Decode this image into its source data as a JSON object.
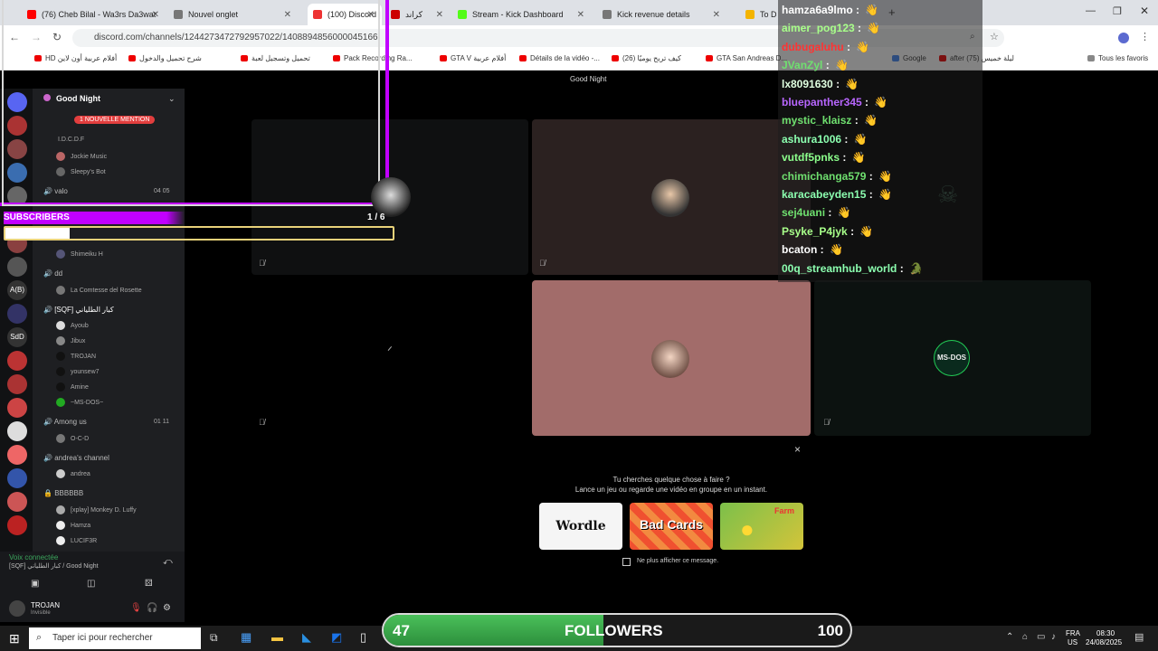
{
  "browser": {
    "tabs": [
      {
        "label": "(76) Cheb Bilal - Wa3rs Da3wat",
        "fav": "#ff0000"
      },
      {
        "label": "Nouvel onglet",
        "fav": "#777777"
      },
      {
        "label": "(100) Discord |",
        "fav": "#e33"
      },
      {
        "label": "كراند",
        "fav": "#c00"
      },
      {
        "label": "Stream - Kick Dashboard",
        "fav": "#53fc18"
      },
      {
        "label": "Kick revenue details",
        "fav": "#777777"
      },
      {
        "label": "To De",
        "fav": "#f4b400"
      }
    ],
    "new_tab": "+",
    "url": "discord.com/channels/1244273472792957022/1408894856000045166",
    "bookmarks": [
      "HD أفلام عربية أون لاين",
      "شرح تحميل والدخول",
      "تحميل وتسجيل لعبة",
      "Pack Recording Ra...",
      "GTA V أفلام عربية",
      "Détails de la vidéo -...",
      "كيف تربح يوميًا (26)",
      "GTA San Andreas D...",
      "Google",
      "after ليلة خميس (75)",
      "Tous les favoris"
    ],
    "window_title": "Good Night"
  },
  "discord": {
    "server_name": "Good Night",
    "new_mention_badge": "1 NOUVELLE MENTION",
    "channels": [
      {
        "name": "valo",
        "counts": "04   05"
      },
      {
        "name": "dd",
        "counts": ""
      },
      {
        "name": "[SQF] كبار الطلياني",
        "counts": ""
      },
      {
        "name": "Among us",
        "counts": "01   11"
      },
      {
        "name": "andrea's channel",
        "counts": ""
      },
      {
        "name": "BBBBBB",
        "counts": ""
      }
    ],
    "members": {
      "top": [
        "I.D.C.D.F",
        "Jockie Music",
        "Sleepy's Bot"
      ],
      "mid": [
        "Shimeiku H"
      ],
      "dd": [
        "La Comtesse del Rosette"
      ],
      "sqf": [
        "Ayoub",
        "Jibux",
        "TROJAN",
        "younsew7",
        "Amine",
        "~MS-DOS~"
      ],
      "among": [
        "O-C-D"
      ],
      "andrea": [
        "andrea"
      ],
      "last": [
        "[xplay] Monkey D. Luffy",
        "Hamza",
        "LUCIF3R"
      ]
    },
    "voice_status": "Voix connectée",
    "voice_channel": "[SQF] كبار الطلياني / Good Night",
    "username": "TROJAN",
    "user_status": "Invisible"
  },
  "activity": {
    "line1": "Tu cherches quelque chose à faire ?",
    "line2": "Lance un jeu ou regarde une vidéo en groupe en un instant.",
    "games": [
      "Wordle",
      "Bad Cards",
      "Farm"
    ],
    "checkbox_label": "Ne plus afficher ce message.",
    "close": "×"
  },
  "overlay": {
    "subscribers_label": "SUBSCRIBERS",
    "subscribers_count": "1 / 6",
    "followers_label": "FOLLOWERS",
    "followers_current": "47",
    "followers_goal": "100",
    "followers_progress": 0.47,
    "tile_label": "MS-DOS"
  },
  "chat": [
    {
      "user": "hamza6a9lmo",
      "color": "#ffffff",
      "emote": "👋"
    },
    {
      "user": "aimer_pog123",
      "color": "#a8ff8a",
      "emote": "👋"
    },
    {
      "user": "dubugaluhu",
      "color": "#ff3333",
      "emote": "👋"
    },
    {
      "user": "JVanZyl",
      "color": "#6fe06f",
      "emote": "👋"
    },
    {
      "user": "lx8091630",
      "color": "#e0ffe0",
      "emote": "👋"
    },
    {
      "user": "bluepanther345",
      "color": "#b866ff",
      "emote": "👋"
    },
    {
      "user": "mystic_klaisz",
      "color": "#6fe06f",
      "emote": "👋"
    },
    {
      "user": "ashura1006",
      "color": "#8cffb0",
      "emote": "👋"
    },
    {
      "user": "vutdf5pnks",
      "color": "#8cff8c",
      "emote": "👋"
    },
    {
      "user": "chimichanga579",
      "color": "#6fe06f",
      "emote": "👋"
    },
    {
      "user": "karacabeyden15",
      "color": "#8cffb0",
      "emote": "👋"
    },
    {
      "user": "sej4uani",
      "color": "#6fe06f",
      "emote": "👋"
    },
    {
      "user": "Psyke_P4jyk",
      "color": "#a8ff8a",
      "emote": "👋"
    },
    {
      "user": "bcaton",
      "color": "#ffffff",
      "emote": "👋"
    },
    {
      "user": "00q_streamhub_world",
      "color": "#8cffb0",
      "emote": "🐊"
    }
  ],
  "taskbar": {
    "search_placeholder": "Taper ici pour rechercher",
    "lang": "FRA",
    "region": "US",
    "time": "08:30",
    "date": "24/08/2025"
  },
  "colors": {
    "accent": "#c100ff",
    "followers": "#3aa84a",
    "discord_bg": "#000000"
  }
}
